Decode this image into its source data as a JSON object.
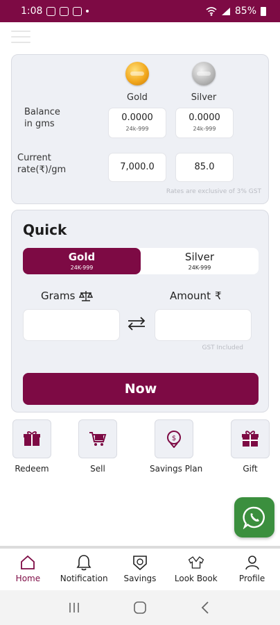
{
  "status_bar": {
    "time": "1:08",
    "battery": "85%"
  },
  "rates": {
    "gold_label": "Gold",
    "silver_label": "Silver",
    "balance_label_line1": "Balance",
    "balance_label_line2": "in gms",
    "gold_balance": "0.0000",
    "silver_balance": "0.0000",
    "gold_karat": "24k-999",
    "silver_karat": "24k-999",
    "rate_label_line1": "Current",
    "rate_label_line2": "rate(₹)/gm",
    "gold_rate": "7,000.0",
    "silver_rate": "85.0",
    "note": "Rates are exclusive of 3% GST"
  },
  "quick": {
    "title": "Quick",
    "toggle": [
      {
        "name": "Gold",
        "karat": "24K-999",
        "active": true
      },
      {
        "name": "Silver",
        "karat": "24K-999",
        "active": false
      }
    ],
    "grams_label": "Grams",
    "amount_label": "Amount",
    "rupee_symbol": "₹",
    "gst_note": "GST Included",
    "now_button": "Now"
  },
  "shortcuts": [
    {
      "label": "Redeem",
      "icon": "gift-box-icon"
    },
    {
      "label": "Sell",
      "icon": "cart-icon"
    },
    {
      "label": "Savings Plan",
      "icon": "savings-coin-icon"
    },
    {
      "label": "Gift",
      "icon": "gift-icon"
    }
  ],
  "tabs": [
    {
      "label": "Home",
      "icon": "home-icon",
      "active": true
    },
    {
      "label": "Notification",
      "icon": "bell-icon",
      "active": false
    },
    {
      "label": "Savings",
      "icon": "savings-icon",
      "active": false
    },
    {
      "label": "Look Book",
      "icon": "shirt-icon",
      "active": false
    },
    {
      "label": "Profile",
      "icon": "person-icon",
      "active": false
    }
  ],
  "colors": {
    "brand": "#7d0a44",
    "card_bg": "#eef0f5",
    "whatsapp": "#3b8f3e"
  }
}
